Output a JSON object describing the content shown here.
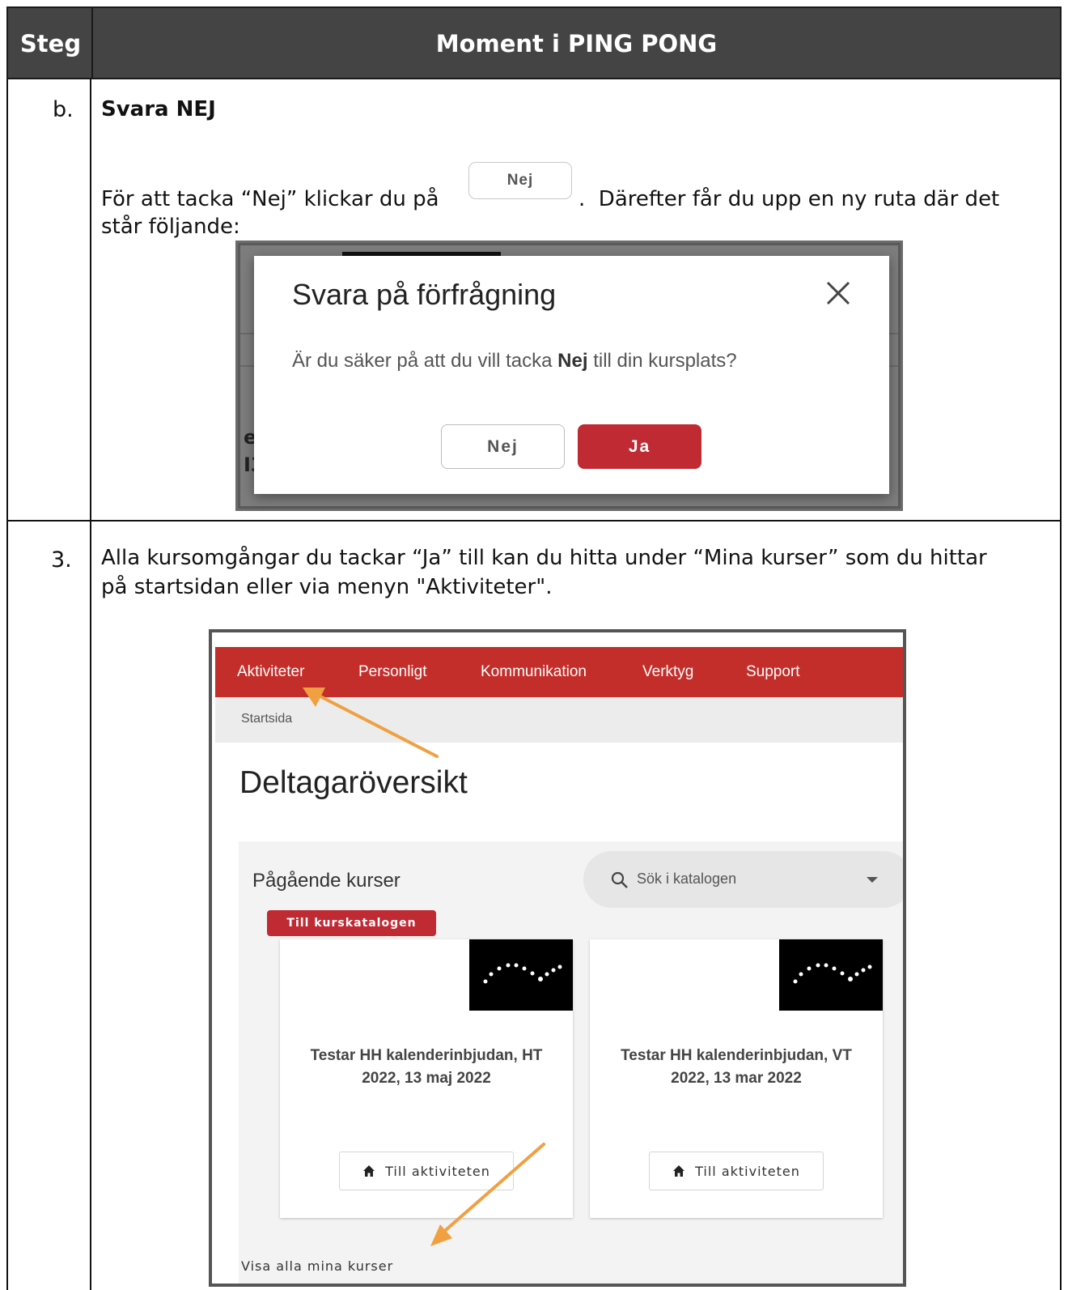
{
  "table": {
    "header_step": "Steg",
    "header_moment": "Moment i PING PONG"
  },
  "row_b": {
    "step": "b.",
    "heading": "Svara NEJ",
    "text_before": "För att tacka “Nej” klickar du på",
    "inline_button": "Nej",
    "text_after": ".  Därefter får du upp en ny ruta där det",
    "text_line2": "står följande:",
    "dialog": {
      "title": "Svara på förfrågning",
      "message_pre": "Är du säker på att du vill tacka",
      "message_bold": "Nej",
      "message_post": "till din kursplats?",
      "no_button": "Nej",
      "yes_button": "Ja",
      "bg_fragment_1": "e",
      "bg_fragment_2": "I3"
    }
  },
  "row_3": {
    "step": "3.",
    "text_line1": "Alla kursomgångar du tackar “Ja” till kan du hitta under “Mina kurser” som du hittar",
    "text_line2": "på startsidan eller via menyn \"Aktiviteter\".",
    "screenshot": {
      "nav": [
        "Aktiviteter",
        "Personligt",
        "Kommunikation",
        "Verktyg",
        "Support"
      ],
      "breadcrumb": "Startsida",
      "page_title": "Deltagaröversikt",
      "section_title": "Pågående kurser",
      "search_placeholder": "Sök i katalogen",
      "catalog_button": "Till kurskatalogen",
      "cards": [
        {
          "title": "Testar HH kalenderinbjudan, HT 2022, 13 maj 2022",
          "button": "Till aktiviteten"
        },
        {
          "title": "Testar HH kalenderinbjudan, VT 2022, 13 mar 2022",
          "button": "Till aktiviteten"
        }
      ],
      "show_all_link": "Visa alla mina kurser",
      "annotation_arrow_color": "#f0a040"
    }
  },
  "colors": {
    "header_bg": "#444444",
    "brand_red": "#c42e2a",
    "button_red": "#bf2a33"
  }
}
